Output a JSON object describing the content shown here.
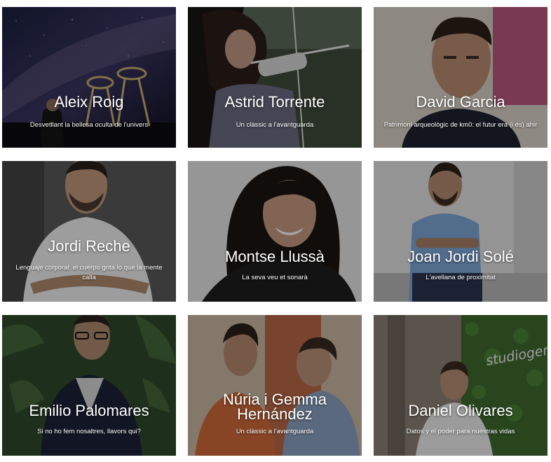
{
  "speakers": [
    {
      "name": "Aleix Roig",
      "tagline": "Desvetllant la bellesa oculta de l'univers"
    },
    {
      "name": "Astrid Torrente",
      "tagline": "Un clàssic a l'avantguarda"
    },
    {
      "name": "David Garcia",
      "tagline": "Patrimoni arqueològic de km0: el futur era (i és) ahir"
    },
    {
      "name": "Jordi Reche",
      "tagline": "Lenguaje corporal: el cuerpo grita lo que la mente calla"
    },
    {
      "name": "Montse Llussà",
      "tagline": "La seva veu et sonarà"
    },
    {
      "name": "Joan Jordi Solé",
      "tagline": "L'avellana de proximitat"
    },
    {
      "name": "Emilio Palomares",
      "tagline": "Si no ho fem nosaltres, llavors qui?"
    },
    {
      "name": "Núria i Gemma Hernández",
      "tagline": "Un clàssic a l'avantguarda"
    },
    {
      "name": "Daniel Olivares",
      "tagline": "Datos y el poder para nuestras vidas"
    }
  ],
  "background_logo_text": "studiogenesis"
}
